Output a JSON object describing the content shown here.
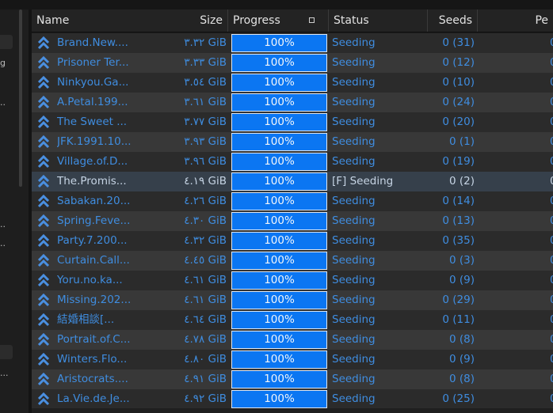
{
  "columns": {
    "name": "Name",
    "size": "Size",
    "progress": "Progress",
    "status": "Status",
    "seeds": "Seeds",
    "peers": "Pe"
  },
  "sidebar_glyphs": [
    "g",
    "..",
    "..",
    "..",
    "..."
  ],
  "torrents": [
    {
      "name": "Brand.New....",
      "size": "٣.٣٢ GiB",
      "progress": "100%",
      "status": "Seeding",
      "seeds": "0 (31)",
      "peers": "0",
      "state_icon": "upload-icon"
    },
    {
      "name": "Prisoner Ter...",
      "size": "٣.٣٣ GiB",
      "progress": "100%",
      "status": "Seeding",
      "seeds": "0 (12)",
      "peers": "0",
      "state_icon": "upload-icon"
    },
    {
      "name": "Ninkyou.Ga...",
      "size": "٣.٥٤ GiB",
      "progress": "100%",
      "status": "Seeding",
      "seeds": "0 (10)",
      "peers": "0",
      "state_icon": "upload-icon"
    },
    {
      "name": "A.Petal.199...",
      "size": "٣.٦١ GiB",
      "progress": "100%",
      "status": "Seeding",
      "seeds": "0 (24)",
      "peers": "0",
      "state_icon": "upload-icon"
    },
    {
      "name": "The Sweet ...",
      "size": "٣.٧٧ GiB",
      "progress": "100%",
      "status": "Seeding",
      "seeds": "0 (20)",
      "peers": "0",
      "state_icon": "upload-icon"
    },
    {
      "name": "JFK.1991.10...",
      "size": "٣.٩٣ GiB",
      "progress": "100%",
      "status": "Seeding",
      "seeds": "0 (1)",
      "peers": "0",
      "state_icon": "upload-icon"
    },
    {
      "name": "Village.of.D...",
      "size": "٣.٩٦ GiB",
      "progress": "100%",
      "status": "Seeding",
      "seeds": "0 (19)",
      "peers": "0",
      "state_icon": "upload-icon"
    },
    {
      "name": "The.Promis...",
      "size": "٤.١٩ GiB",
      "progress": "100%",
      "status": "[F] Seeding",
      "seeds": "0 (2)",
      "peers": "0",
      "state_icon": "upload-icon",
      "selected": true
    },
    {
      "name": "Sabakan.20...",
      "size": "٤.٢٦ GiB",
      "progress": "100%",
      "status": "Seeding",
      "seeds": "0 (14)",
      "peers": "0",
      "state_icon": "upload-icon"
    },
    {
      "name": "Spring.Feve...",
      "size": "٤.٣٠ GiB",
      "progress": "100%",
      "status": "Seeding",
      "seeds": "0 (13)",
      "peers": "0",
      "state_icon": "upload-icon"
    },
    {
      "name": "Party.7.200...",
      "size": "٤.٣٢ GiB",
      "progress": "100%",
      "status": "Seeding",
      "seeds": "0 (35)",
      "peers": "0",
      "state_icon": "upload-icon"
    },
    {
      "name": "Curtain.Call...",
      "size": "٤.٤٥ GiB",
      "progress": "100%",
      "status": "Seeding",
      "seeds": "0 (3)",
      "peers": "0",
      "state_icon": "upload-icon"
    },
    {
      "name": "Yoru.no.ka...",
      "size": "٤.٦١ GiB",
      "progress": "100%",
      "status": "Seeding",
      "seeds": "0 (9)",
      "peers": "0",
      "state_icon": "upload-icon"
    },
    {
      "name": "Missing.202...",
      "size": "٤.٦١ GiB",
      "progress": "100%",
      "status": "Seeding",
      "seeds": "0 (29)",
      "peers": "0",
      "state_icon": "upload-icon"
    },
    {
      "name": "結婚相談[...",
      "size": "٤.٦٤ GiB",
      "progress": "100%",
      "status": "Seeding",
      "seeds": "0 (11)",
      "peers": "0",
      "state_icon": "upload-icon"
    },
    {
      "name": "Portrait.of.C...",
      "size": "٤.٧٨ GiB",
      "progress": "100%",
      "status": "Seeding",
      "seeds": "0 (8)",
      "peers": "0",
      "state_icon": "upload-icon"
    },
    {
      "name": "Winters.Flo...",
      "size": "٤.٨٠ GiB",
      "progress": "100%",
      "status": "Seeding",
      "seeds": "0 (9)",
      "peers": "0",
      "state_icon": "upload-icon"
    },
    {
      "name": "Aristocrats....",
      "size": "٤.٩١ GiB",
      "progress": "100%",
      "status": "Seeding",
      "seeds": "0 (8)",
      "peers": "0",
      "state_icon": "upload-icon"
    },
    {
      "name": "La.Vie.de.Je...",
      "size": "٤.٩٢ GiB",
      "progress": "100%",
      "status": "Seeding",
      "seeds": "0 (25)",
      "peers": "0",
      "state_icon": "upload-icon"
    }
  ],
  "colors": {
    "accent_text": "#3f8de0",
    "progress_fill": "#0b76f2",
    "selected_row": "#36404b",
    "row_even": "#2b2b2b",
    "row_odd": "#383838"
  }
}
